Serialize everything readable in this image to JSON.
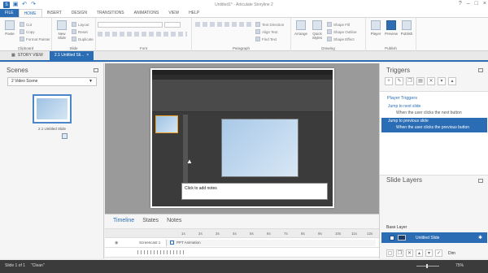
{
  "window": {
    "title": "Untitled1* - Articulate Storyline 2"
  },
  "ribbon_tabs": [
    "FILE",
    "HOME",
    "INSERT",
    "DESIGN",
    "TRANSITIONS",
    "ANIMATIONS",
    "VIEW",
    "HELP"
  ],
  "ribbon": {
    "clipboard": {
      "paste": "Paste",
      "cut": "Cut",
      "copy": "Copy",
      "format_painter": "Format Painter",
      "label": "Clipboard"
    },
    "slide": {
      "new_slide": "New Slide",
      "layout": "Layout",
      "reset": "Reset",
      "duplicate": "Duplicate",
      "label": "Slide"
    },
    "font": {
      "label": "Font"
    },
    "paragraph": {
      "text_direction": "Text Direction",
      "align_text": "Align Text",
      "find_text": "Find Text",
      "label": "Paragraph"
    },
    "drawing": {
      "arrange": "Arrange",
      "quick_styles": "Quick Styles",
      "shape_fill": "Shape Fill",
      "shape_outline": "Shape Outline",
      "shape_effect": "Shape Effect",
      "label": "Drawing"
    },
    "publish": {
      "player": "Player",
      "preview": "Preview",
      "publish": "Publish",
      "label": "Publish"
    }
  },
  "doc_tabs": [
    "STORY VIEW",
    "2.1 Untitled Sli..."
  ],
  "scenes": {
    "title": "Scenes",
    "selected_scene": "2 Video Scene",
    "slide_label": "2.1 Untitled Slide"
  },
  "stage": {
    "notes_placeholder": "Click to add notes"
  },
  "timeline": {
    "tabs": [
      "Timeline",
      "States",
      "Notes"
    ],
    "ruler": [
      "1s",
      "2s",
      "3s",
      "4s",
      "5s",
      "6s",
      "7s",
      "8s",
      "9s",
      "10s",
      "11s",
      "12s"
    ],
    "rows": [
      {
        "name": "Screencast 1",
        "block": "PPT Animation"
      }
    ]
  },
  "triggers": {
    "title": "Triggers",
    "section": "Player Triggers",
    "items": [
      {
        "action": "Jump to next slide",
        "condition": "When the user clicks the next button"
      },
      {
        "action": "Jump to previous slide",
        "condition": "When the user clicks the previous button"
      }
    ]
  },
  "slide_layers": {
    "title": "Slide Layers",
    "base_layer": "Base Layer",
    "layer_name": "Untitled Slide",
    "dim_label": "Dim"
  },
  "status": {
    "slide": "Slide 1 of 1",
    "state": "\"Clean\"",
    "zoom": "75%"
  },
  "colors": {
    "accent": "#2a6db5",
    "status_bar": "#3b3b3b"
  }
}
